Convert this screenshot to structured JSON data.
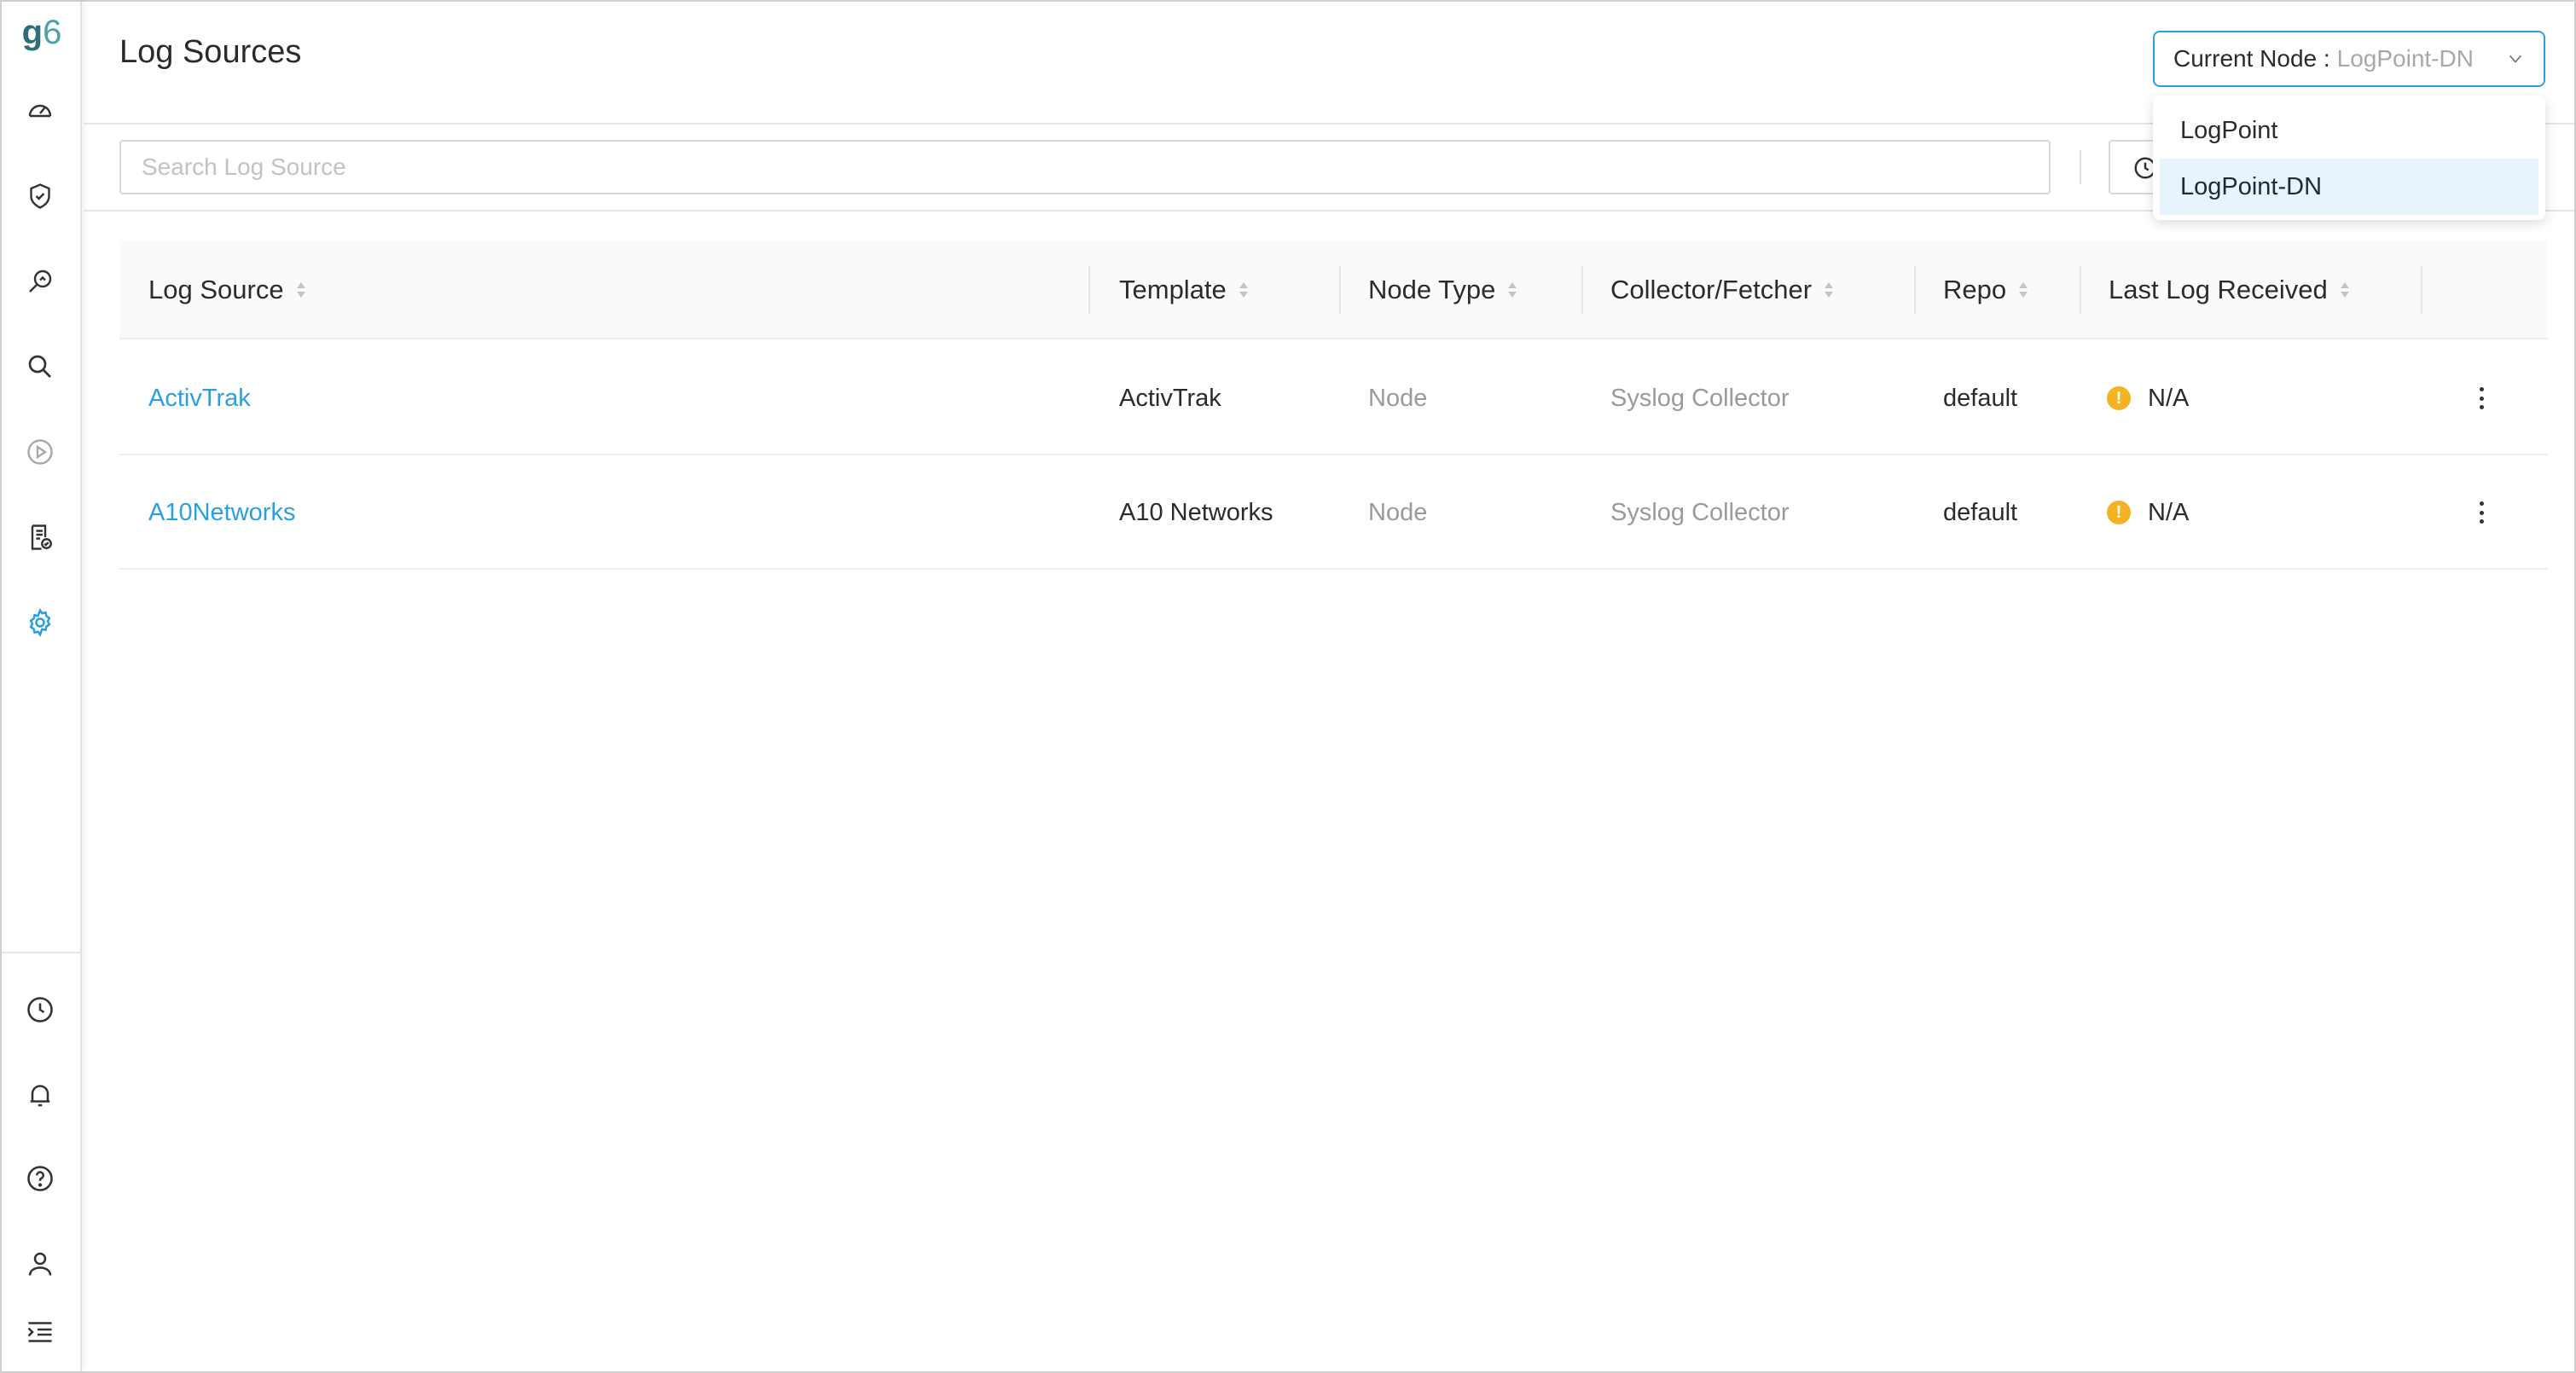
{
  "app": {
    "logo_main": "g",
    "logo_sub": "6"
  },
  "sidebar": {
    "top_items": [
      {
        "icon": "dashboard-gauge-icon"
      },
      {
        "icon": "shield-check-icon"
      },
      {
        "icon": "search-analytics-icon"
      },
      {
        "icon": "search-icon"
      },
      {
        "icon": "play-circle-icon"
      },
      {
        "icon": "report-icon"
      },
      {
        "icon": "gear-icon",
        "active": true
      }
    ],
    "bottom_items": [
      {
        "icon": "clock-icon"
      },
      {
        "icon": "bell-icon"
      },
      {
        "icon": "help-icon"
      },
      {
        "icon": "user-icon"
      },
      {
        "icon": "collapse-menu-icon"
      }
    ]
  },
  "header": {
    "title": "Log Sources",
    "node_select": {
      "label": "Current Node :",
      "value": "LogPoint-DN"
    },
    "node_options": [
      "LogPoint",
      "LogPoint-DN"
    ]
  },
  "toolbar": {
    "search_placeholder": "Search Log Source"
  },
  "table": {
    "columns": [
      "Log Source",
      "Template",
      "Node Type",
      "Collector/Fetcher",
      "Repo",
      "Last Log Received"
    ],
    "rows": [
      {
        "log_source": "ActivTrak",
        "template": "ActivTrak",
        "node_type": "Node",
        "collector": "Syslog Collector",
        "repo": "default",
        "last_log": "N/A"
      },
      {
        "log_source": "A10Networks",
        "template": "A10 Networks",
        "node_type": "Node",
        "collector": "Syslog Collector",
        "repo": "default",
        "last_log": "N/A"
      }
    ],
    "warning_glyph": "!"
  },
  "colors": {
    "accent": "#2aa0df",
    "warning": "#f5b324",
    "selected_option_bg": "#e8f4fb"
  }
}
